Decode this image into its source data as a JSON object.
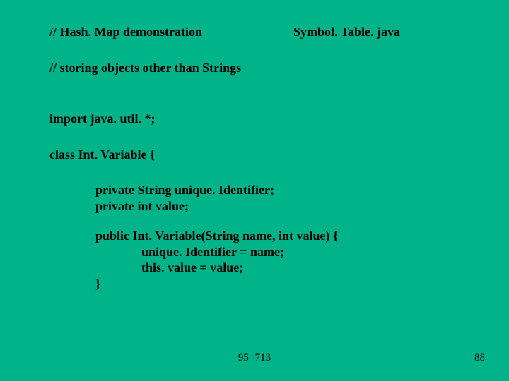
{
  "header": {
    "left": "// Hash. Map demonstration",
    "right": "Symbol. Table. java"
  },
  "lines": {
    "comment2": "// storing objects other than Strings",
    "import": "import java. util. *;",
    "classDecl": "class Int. Variable {",
    "field1": "private String unique. Identifier;",
    "field2": "private int value;",
    "ctor": "public Int. Variable(String name, int value) {",
    "body1": "unique. Identifier = name;",
    "body2": "this. value = value;",
    "closeCtor": "}"
  },
  "footer": {
    "center": "95 -713",
    "page": "88"
  }
}
